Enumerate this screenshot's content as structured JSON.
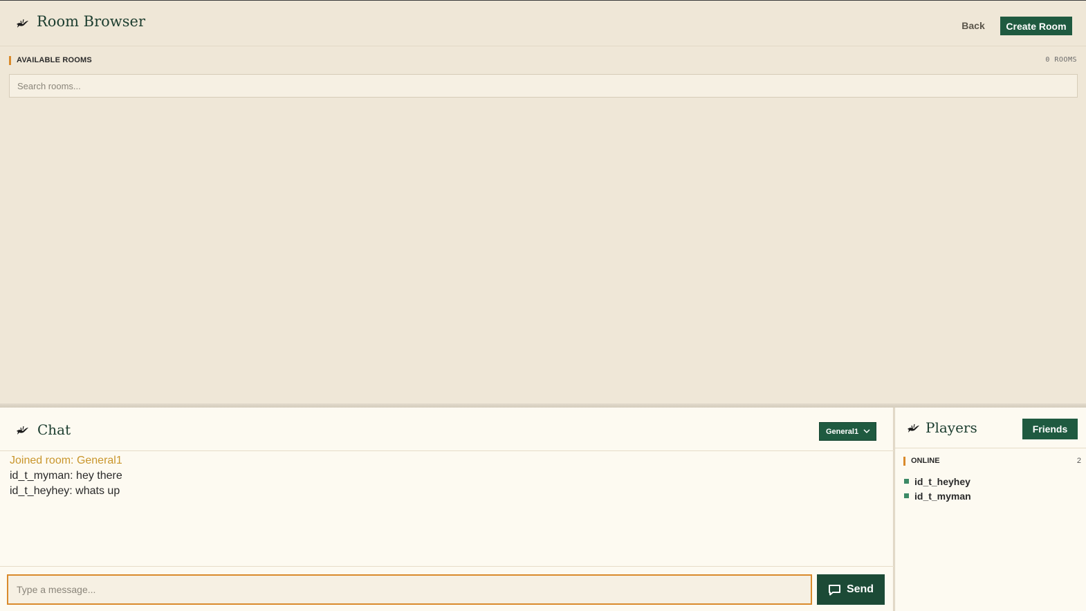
{
  "header": {
    "title": "Room Browser",
    "back_label": "Back",
    "create_label": "Create Room"
  },
  "rooms": {
    "section_label": "AVAILABLE ROOMS",
    "count_label": "0 ROOMS",
    "search_placeholder": "Search rooms..."
  },
  "chat": {
    "title": "Chat",
    "selected_room": "General1",
    "messages": [
      {
        "text": "Joined room: General1",
        "type": "system"
      },
      {
        "text": "id_t_myman: hey there",
        "type": "user"
      },
      {
        "text": "id_t_heyhey: whats up",
        "type": "user"
      }
    ],
    "input_placeholder": "Type a message...",
    "send_label": "Send"
  },
  "players": {
    "title": "Players",
    "friends_label": "Friends",
    "online_label": "ONLINE",
    "online_count": "2",
    "list": [
      {
        "name": "id_t_heyhey"
      },
      {
        "name": "id_t_myman"
      }
    ]
  },
  "colors": {
    "accent": "#d98a2b",
    "brand_green": "#1f5a40",
    "online_dot": "#3c8a66",
    "system_message": "#c9962c"
  }
}
